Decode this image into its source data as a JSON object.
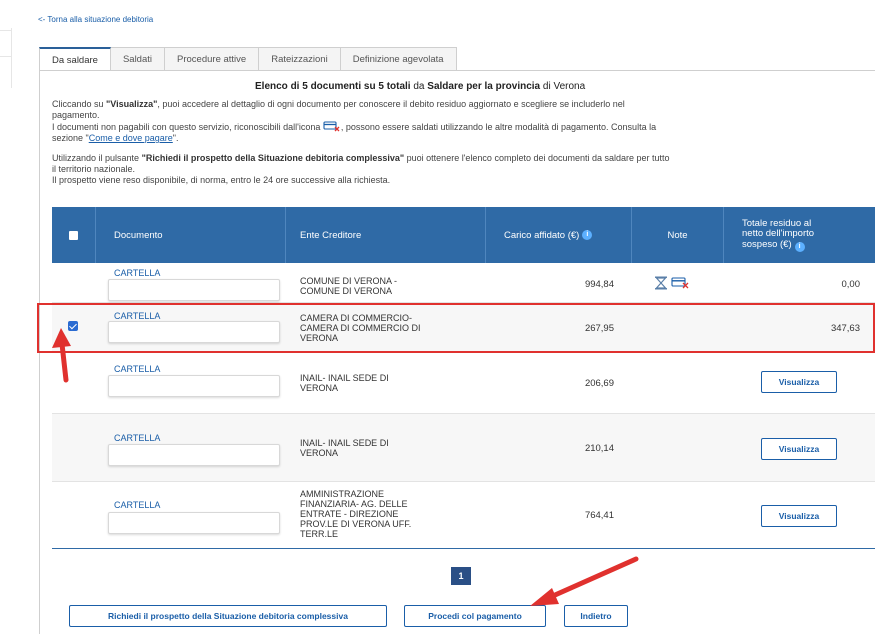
{
  "nav": {
    "back_link": "<- Torna alla situazione debitoria"
  },
  "tabs": [
    {
      "label": "Da saldare",
      "active": true
    },
    {
      "label": "Saldati",
      "active": false
    },
    {
      "label": "Procedure attive",
      "active": false
    },
    {
      "label": "Rateizzazioni",
      "active": false
    },
    {
      "label": "Definizione agevolata",
      "active": false
    }
  ],
  "heading": {
    "part1": "Elenco di 5 documenti su 5 totali",
    "part2": " da ",
    "part3": "Saldare per la provincia",
    "part4": " di Verona"
  },
  "intro": {
    "p1_a": "Cliccando su ",
    "p1_b": "\"Visualizza\"",
    "p1_c": ", puoi accedere al dettaglio di ogni documento per conoscere il debito residuo aggiornato e scegliere se includerlo nel",
    "p1_d": "pagamento.",
    "p2_a": "I documenti non pagabili con questo servizio, riconoscibili dall'icona",
    "p2_b": ", possono essere saldati utilizzando le altre modalità di pagamento. Consulta la",
    "p2_c": "sezione \"",
    "p2_link": "Come e dove pagare",
    "p2_d": "\".",
    "p3_a": "Utilizzando il pulsante ",
    "p3_b": "\"Richiedi il prospetto della Situazione debitoria complessiva\"",
    "p3_c": " puoi ottenere l'elenco completo dei documenti da saldare per tutto",
    "p3_d": "il territorio nazionale.",
    "p3_e": "Il prospetto viene reso disponibile, di norma, entro le 24 ore successive alla richiesta."
  },
  "table": {
    "headers": {
      "documento": "Documento",
      "ente": "Ente Creditore",
      "carico": "Carico affidato (€)",
      "note": "Note",
      "totale_l1": "Totale residuo al",
      "totale_l2": "netto dell'importo",
      "totale_l3": "sospeso (€)"
    },
    "rows": [
      {
        "doc": "CARTELLA",
        "ente": [
          "COMUNE DI VERONA -",
          "COMUNE DI VERONA"
        ],
        "carico": "994,84",
        "totale": "0,00",
        "checked": false,
        "not_payable": true
      },
      {
        "doc": "CARTELLA",
        "ente": [
          "CAMERA DI COMMERCIO-",
          "CAMERA DI COMMERCIO DI",
          "VERONA"
        ],
        "carico": "267,95",
        "totale": "347,63",
        "checked": true
      },
      {
        "doc": "CARTELLA",
        "ente": [
          "INAIL- INAIL SEDE DI",
          "VERONA"
        ],
        "carico": "206,69",
        "action": "Visualizza"
      },
      {
        "doc": "CARTELLA",
        "ente": [
          "INAIL- INAIL SEDE DI",
          "VERONA"
        ],
        "carico": "210,14",
        "action": "Visualizza"
      },
      {
        "doc": "CARTELLA",
        "ente": [
          "AMMINISTRAZIONE",
          "FINANZIARIA- AG. DELLE",
          "ENTRATE - DIREZIONE",
          "PROV.LE DI VERONA UFF.",
          "TERR.LE"
        ],
        "carico": "764,41",
        "action": "Visualizza"
      }
    ]
  },
  "pagination": {
    "current": "1"
  },
  "footer": {
    "prospetto": "Richiedi il prospetto della Situazione debitoria complessiva",
    "procedi": "Procedi col pagamento",
    "indietro": "Indietro"
  },
  "colors": {
    "header_blue": "#2f6aa6",
    "link_blue": "#1a5ea8",
    "annotation_red": "#e0312e"
  },
  "icons": {
    "hourglass": "hourglass-icon",
    "not_payable": "card-cross-icon"
  }
}
